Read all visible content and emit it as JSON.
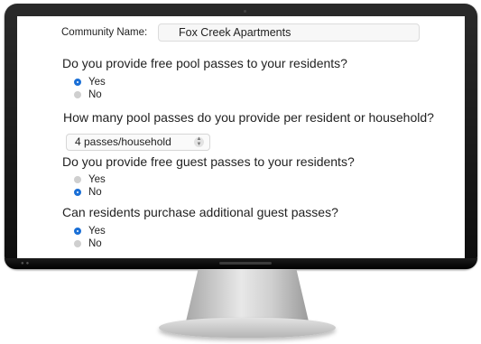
{
  "form": {
    "community_label": "Community Name:",
    "community_value": "Fox Creek Apartments",
    "q1": {
      "text": "Do you provide free pool passes to your residents?",
      "options": [
        {
          "label": "Yes",
          "checked": true
        },
        {
          "label": "No",
          "checked": false
        }
      ]
    },
    "q2": {
      "text": "How many pool passes do you provide per resident or household?",
      "selected": "4 passes/household"
    },
    "q3": {
      "text": "Do you provide free guest passes to your residents?",
      "options": [
        {
          "label": "Yes",
          "checked": false
        },
        {
          "label": "No",
          "checked": true
        }
      ]
    },
    "q4": {
      "text": "Can residents purchase additional guest passes?",
      "options": [
        {
          "label": "Yes",
          "checked": true
        },
        {
          "label": "No",
          "checked": false
        }
      ]
    }
  },
  "icons": {
    "select_arrows": "up-down-chevron-icon"
  },
  "colors": {
    "radio_checked": "#1a6fd6",
    "radio_unchecked": "#cfcfcf"
  }
}
